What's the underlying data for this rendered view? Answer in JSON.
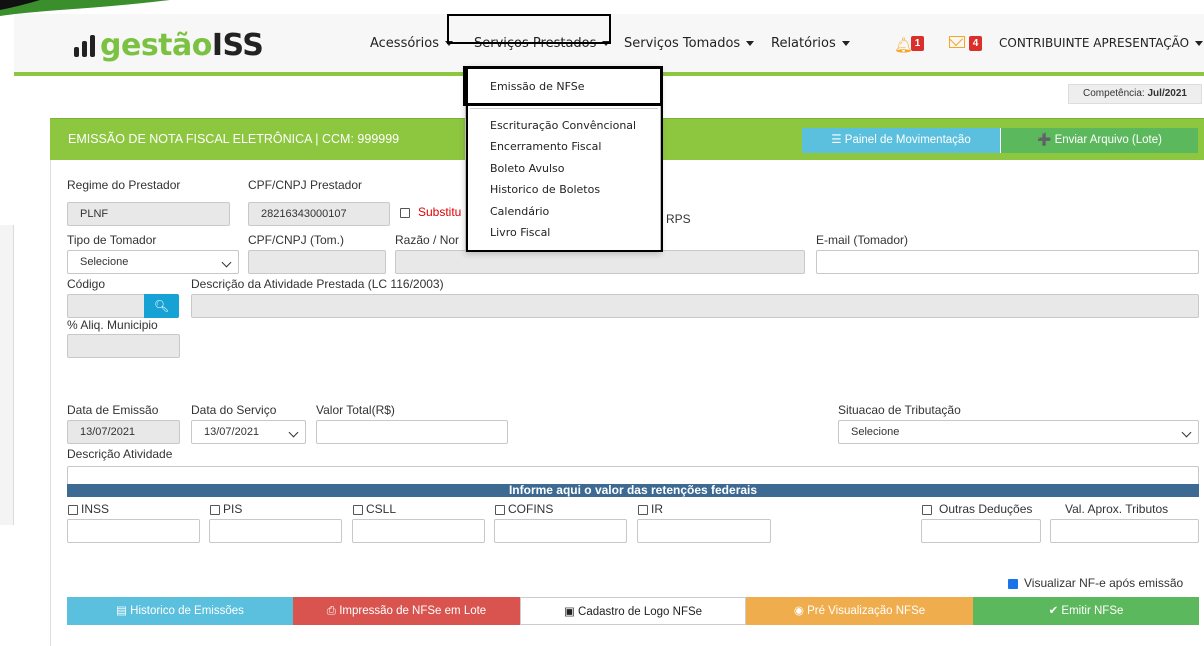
{
  "brand": {
    "name_prefix": "gestão",
    "name_suffix": "ISS"
  },
  "nav": {
    "items": [
      {
        "label": "Acessórios"
      },
      {
        "label": "Serviços Prestados"
      },
      {
        "label": "Serviços Tomados"
      },
      {
        "label": "Relatórios"
      }
    ],
    "notifications": {
      "alerts_count": "1",
      "messages_count": "4"
    },
    "user": "CONTRIBUINTE APRESENTAÇÃO"
  },
  "dropdown": {
    "items": [
      {
        "label": "Emissão de NFSe"
      },
      {
        "label": "Escrituração Convêncional"
      },
      {
        "label": "Encerramento Fiscal"
      },
      {
        "label": "Boleto Avulso"
      },
      {
        "label": "Historico de Boletos"
      },
      {
        "label": "Calendário"
      },
      {
        "label": "Livro Fiscal"
      }
    ]
  },
  "competencia": {
    "label": "Competência:",
    "value": "Jul/2021"
  },
  "panel": {
    "title": "EMISSÃO DE NOTA FISCAL ELETRÔNICA | CCM: 999999",
    "painel_button": "Painel de Movimentação",
    "enviar_button": "Enviar Arquivo (Lote)"
  },
  "form": {
    "regime_label": "Regime do Prestador",
    "regime_value": "PLNF",
    "cpf_prestador_label": "CPF/CNPJ Prestador",
    "cpf_prestador_value": "28216343000107",
    "substituicao_label": "Substitu",
    "rps_label": "RPS",
    "tipo_tomador_label": "Tipo de Tomador",
    "tipo_tomador_value": "Selecione",
    "cpf_tomador_label": "CPF/CNPJ (Tom.)",
    "razao_label": "Razão / Nor",
    "email_label": "E-mail (Tomador)",
    "codigo_label": "Código",
    "descricao_atividade_prestada_label": "Descrição da Atividade Prestada (LC 116/2003)",
    "aliq_label": "% Aliq. Municipio",
    "data_emissao_label": "Data de Emissão",
    "data_emissao_value": "13/07/2021",
    "data_servico_label": "Data do Serviço",
    "data_servico_value": "13/07/2021",
    "valor_total_label": "Valor Total(R$)",
    "situacao_label": "Situacao de Tributação",
    "situacao_value": "Selecione",
    "descricao_atividade_label": "Descrição Atividade"
  },
  "retencoes": {
    "header": "Informe aqui o valor das retenções federais",
    "items": [
      {
        "label": "INSS"
      },
      {
        "label": "PIS"
      },
      {
        "label": "CSLL"
      },
      {
        "label": "COFINS"
      },
      {
        "label": "IR"
      }
    ],
    "outras_label": "Outras Deduções",
    "val_aprox_label": "Val. Aprox. Tributos",
    "visualizar_label": "Visualizar NF-e após emissão"
  },
  "actions": {
    "historico": "Historico de Emissões",
    "impressao": "Impressão de NFSe em Lote",
    "cadastro_logo": "Cadastro de Logo NFSe",
    "pre_visualizacao": "Pré Visualização NFSe",
    "emitir": "Emitir NFSe"
  },
  "colors": {
    "green": "#8dc63f",
    "blue": "#5bc0de",
    "red": "#d9534f",
    "orange": "#f0ad4e",
    "success": "#5cb85c",
    "navy": "#3d6a92"
  }
}
